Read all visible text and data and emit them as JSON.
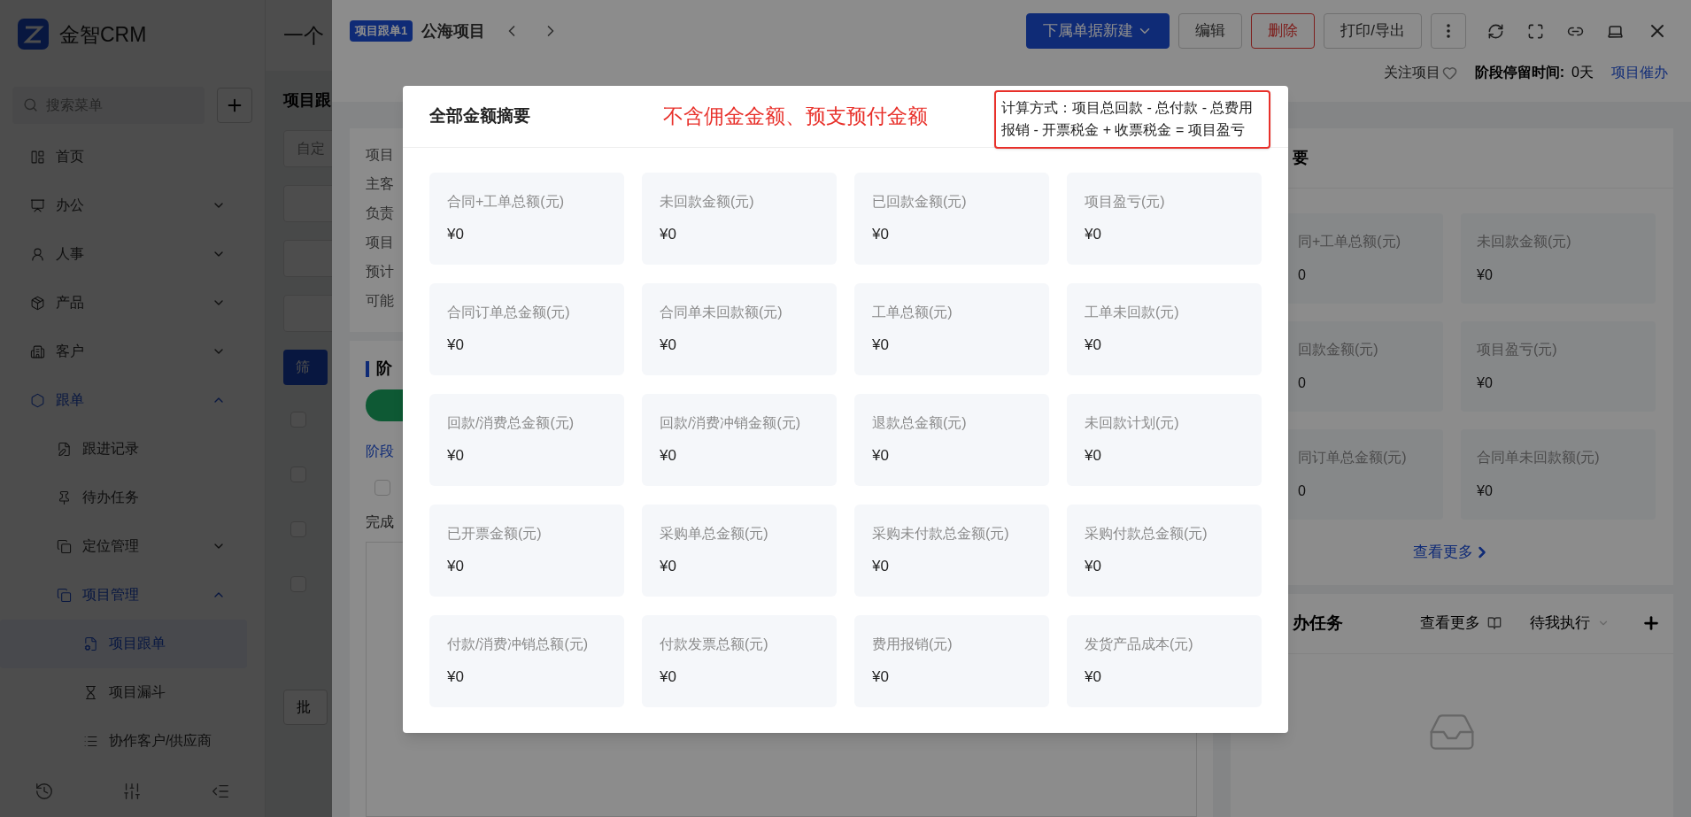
{
  "app": {
    "logo_text": "金智CRM",
    "search_placeholder": "搜索菜单"
  },
  "sidebar": {
    "items": [
      {
        "label": "首页",
        "selected": false
      },
      {
        "label": "办公",
        "selected": false,
        "expanded": false
      },
      {
        "label": "人事",
        "selected": false,
        "expanded": false
      },
      {
        "label": "产品",
        "selected": false,
        "expanded": false
      },
      {
        "label": "客户",
        "selected": false,
        "expanded": false
      },
      {
        "label": "跟单",
        "expanded": true,
        "children": [
          {
            "label": "跟进记录",
            "selected": false
          },
          {
            "label": "待办任务",
            "selected": false
          },
          {
            "label": "定位管理",
            "selected": false,
            "expanded": false
          },
          {
            "label": "项目管理",
            "expanded": true,
            "children": [
              {
                "label": "项目跟单",
                "selected": true
              },
              {
                "label": "项目漏斗",
                "selected": false
              },
              {
                "label": "协作客户/供应商",
                "selected": false
              }
            ]
          }
        ]
      }
    ]
  },
  "page_behind": {
    "title": "一个",
    "subtitle": "项目跟",
    "filter_placeholder": "自定",
    "filter_button": "筛",
    "batch_button": "批",
    "rows": [
      {
        "checked": false
      },
      {
        "checked": false
      },
      {
        "checked": false
      },
      {
        "checked": false
      }
    ]
  },
  "drawer": {
    "tag": "项目跟单1",
    "title": "公海项目",
    "actions": [
      {
        "label": "下属单据新建",
        "kind": "primary"
      },
      {
        "label": "编辑",
        "kind": "default"
      },
      {
        "label": "删除",
        "kind": "danger"
      },
      {
        "label": "打印/导出",
        "kind": "default"
      }
    ],
    "follow": "关注项目",
    "stay_label": "阶段停留时间:",
    "stay_value": "0天",
    "urge": "项目催办",
    "info_labels": [
      "项目",
      "主客",
      "负责",
      "项目",
      "预计",
      "可能"
    ],
    "stage_heading": "阶",
    "stage_link": "阶段",
    "stage_check": {
      "checked": false
    },
    "done_label": "完成",
    "summary": {
      "heading": "要",
      "cards": [
        {
          "label": "同+工单总额(元)",
          "value": "0"
        },
        {
          "label": "未回款金额(元)",
          "value": "¥0"
        },
        {
          "label": "回款金额(元)",
          "value": "0"
        },
        {
          "label": "项目盈亏(元)",
          "value": "¥0"
        },
        {
          "label": "同订单总金额(元)",
          "value": "0"
        },
        {
          "label": "合同单未回款额(元)",
          "value": "¥0"
        }
      ],
      "view_more": "查看更多"
    },
    "tasks": {
      "heading": "办任务",
      "view_more": "查看更多",
      "filter": "待我执行"
    }
  },
  "modal": {
    "title": "全部金额摘要",
    "note": "不含佣金金额、预支预付金额",
    "tooltip": "计算方式：项目总回款 - 总付款 - 总费用报销 - 开票税金 + 收票税金 = 项目盈亏",
    "cards": [
      {
        "label": "合同+工单总额(元)",
        "value": "¥0"
      },
      {
        "label": "未回款金额(元)",
        "value": "¥0"
      },
      {
        "label": "已回款金额(元)",
        "value": "¥0"
      },
      {
        "label": "项目盈亏(元)",
        "value": "¥0"
      },
      {
        "label": "合同订单总金额(元)",
        "value": "¥0"
      },
      {
        "label": "合同单未回款额(元)",
        "value": "¥0"
      },
      {
        "label": "工单总额(元)",
        "value": "¥0"
      },
      {
        "label": "工单未回款(元)",
        "value": "¥0"
      },
      {
        "label": "回款/消费总金额(元)",
        "value": "¥0"
      },
      {
        "label": "回款/消费冲销金额(元)",
        "value": "¥0"
      },
      {
        "label": "退款总金额(元)",
        "value": "¥0"
      },
      {
        "label": "未回款计划(元)",
        "value": "¥0"
      },
      {
        "label": "已开票金额(元)",
        "value": "¥0"
      },
      {
        "label": "采购单总金额(元)",
        "value": "¥0"
      },
      {
        "label": "采购未付款总金额(元)",
        "value": "¥0"
      },
      {
        "label": "采购付款总金额(元)",
        "value": "¥0"
      },
      {
        "label": "付款/消费冲销总额(元)",
        "value": "¥0"
      },
      {
        "label": "付款发票总额(元)",
        "value": "¥0"
      },
      {
        "label": "费用报销(元)",
        "value": "¥0"
      },
      {
        "label": "发货产品成本(元)",
        "value": "¥0"
      }
    ]
  }
}
